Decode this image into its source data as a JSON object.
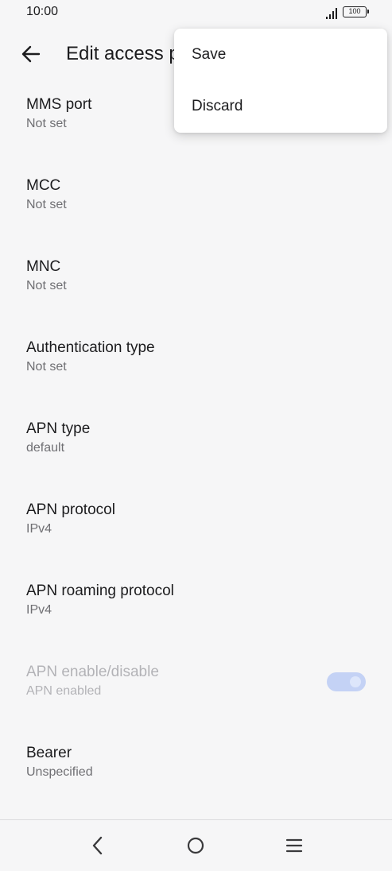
{
  "status_bar": {
    "time": "10:00",
    "battery": "100"
  },
  "header": {
    "title": "Edit access point",
    "back_icon": "arrow-left-icon"
  },
  "menu": {
    "items": [
      {
        "label": "Save"
      },
      {
        "label": "Discard"
      }
    ]
  },
  "settings": {
    "items": [
      {
        "title": "MMS port",
        "summary": "Not set"
      },
      {
        "title": "MCC",
        "summary": "Not set"
      },
      {
        "title": "MNC",
        "summary": "Not set"
      },
      {
        "title": "Authentication type",
        "summary": "Not set"
      },
      {
        "title": "APN type",
        "summary": "default"
      },
      {
        "title": "APN protocol",
        "summary": "IPv4"
      },
      {
        "title": "APN roaming protocol",
        "summary": "IPv4"
      },
      {
        "title": "APN enable/disable",
        "summary": "APN enabled",
        "toggle_on": true,
        "enabled": false
      },
      {
        "title": "Bearer",
        "summary": "Unspecified"
      }
    ]
  },
  "colors": {
    "background": "#f6f6f7",
    "toggle_track": "#c4d2f5",
    "disabled_text": "#b3b3b7"
  },
  "nav_bar": {
    "icons": [
      "back-icon",
      "home-icon",
      "recents-icon"
    ]
  }
}
